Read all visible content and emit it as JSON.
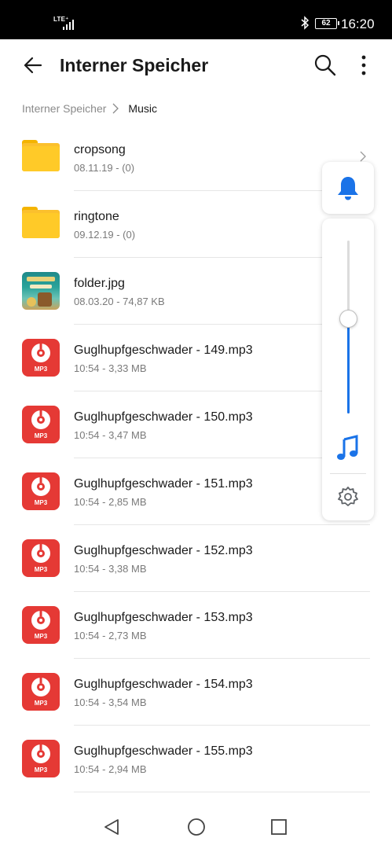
{
  "status_bar": {
    "network": "LTE⁺",
    "battery": "62",
    "time": "16:20"
  },
  "header": {
    "title": "Interner Speicher"
  },
  "breadcrumb": {
    "root": "Interner Speicher",
    "current": "Music"
  },
  "files": [
    {
      "name": "cropsong",
      "meta": "08.11.19 - (0)",
      "type": "folder"
    },
    {
      "name": "ringtone",
      "meta": "09.12.19 - (0)",
      "type": "folder"
    },
    {
      "name": "folder.jpg",
      "meta": "08.03.20 - 74,87 KB",
      "type": "image"
    },
    {
      "name": "Guglhupfgeschwader - 149.mp3",
      "meta": "10:54 - 3,33 MB",
      "type": "mp3"
    },
    {
      "name": "Guglhupfgeschwader - 150.mp3",
      "meta": "10:54 - 3,47 MB",
      "type": "mp3"
    },
    {
      "name": "Guglhupfgeschwader - 151.mp3",
      "meta": "10:54 - 2,85 MB",
      "type": "mp3"
    },
    {
      "name": "Guglhupfgeschwader - 152.mp3",
      "meta": "10:54 - 3,38 MB",
      "type": "mp3"
    },
    {
      "name": "Guglhupfgeschwader - 153.mp3",
      "meta": "10:54 - 2,73 MB",
      "type": "mp3"
    },
    {
      "name": "Guglhupfgeschwader - 154.mp3",
      "meta": "10:54 - 3,54 MB",
      "type": "mp3"
    },
    {
      "name": "Guglhupfgeschwader - 155.mp3",
      "meta": "10:54 - 2,94 MB",
      "type": "mp3"
    }
  ],
  "mp3_label": "MP3",
  "volume_panel": {
    "ringer_icon": "bell-icon",
    "media_icon": "music-note-icon",
    "settings_icon": "gear-icon",
    "level": 0.55,
    "accent": "#1a73e8"
  },
  "colors": {
    "folder": "#fbc02d",
    "mp3": "#e53935",
    "accent": "#1a73e8"
  }
}
